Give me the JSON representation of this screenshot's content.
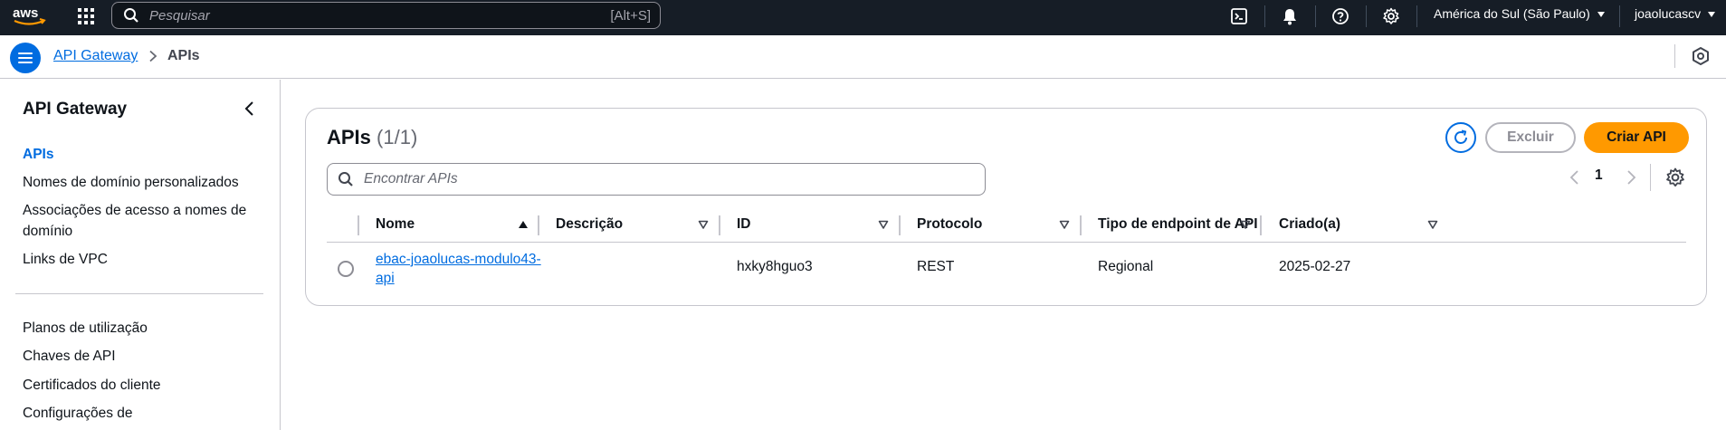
{
  "topnav": {
    "search_placeholder": "Pesquisar",
    "search_shortcut": "[Alt+S]",
    "region": "América do Sul (São Paulo)",
    "user": "joaolucascv"
  },
  "breadcrumb": {
    "parent": "API Gateway",
    "current": "APIs"
  },
  "sidebar": {
    "title": "API Gateway",
    "items": [
      {
        "label": "APIs",
        "active": true
      },
      {
        "label": "Nomes de domínio personalizados"
      },
      {
        "label": "Associações de acesso a nomes de domínio"
      },
      {
        "label": "Links de VPC"
      }
    ],
    "items2": [
      {
        "label": "Planos de utilização"
      },
      {
        "label": "Chaves de API"
      },
      {
        "label": "Certificados do cliente"
      },
      {
        "label": "Configurações de"
      }
    ]
  },
  "panel": {
    "title": "APIs",
    "count": "(1/1)",
    "delete_label": "Excluir",
    "create_label": "Criar API",
    "find_placeholder": "Encontrar APIs",
    "page": "1"
  },
  "table": {
    "columns": [
      "Nome",
      "Descrição",
      "ID",
      "Protocolo",
      "Tipo de endpoint de API",
      "Criado(a)"
    ],
    "rows": [
      {
        "name": "ebac-joaolucas-modulo43-api",
        "description": "",
        "id": "hxky8hguo3",
        "protocol": "REST",
        "endpoint_type": "Regional",
        "created": "2025-02-27"
      }
    ]
  },
  "colors": {
    "nav_bg": "#161d26",
    "accent": "#006ce0",
    "primary_button": "#ff9900",
    "border": "#c6c6cd"
  }
}
